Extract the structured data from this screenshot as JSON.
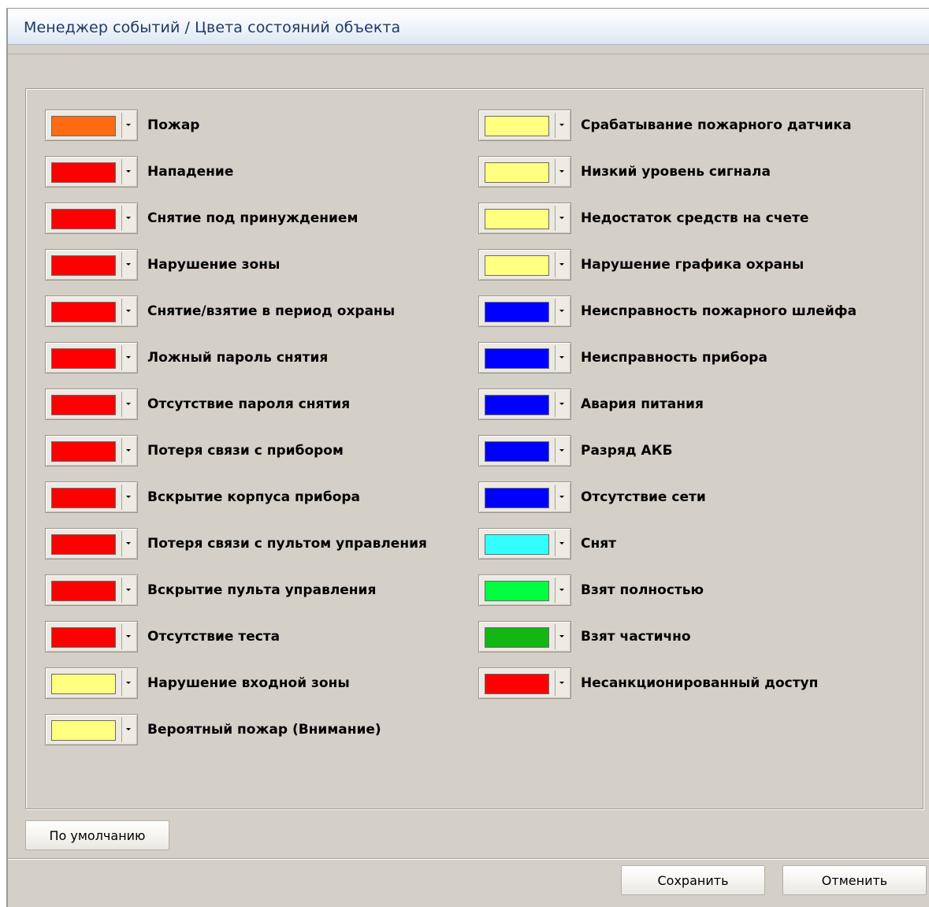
{
  "window": {
    "title": "Менеджер событий / Цвета состояний объекта"
  },
  "left_items": [
    {
      "label": "Пожар",
      "color": "#ff6a13"
    },
    {
      "label": "Нападение",
      "color": "#ff0000"
    },
    {
      "label": "Снятие под принуждением",
      "color": "#ff0000"
    },
    {
      "label": "Нарушение зоны",
      "color": "#ff0000"
    },
    {
      "label": "Снятие/взятие в период охраны",
      "color": "#ff0000"
    },
    {
      "label": "Ложный пароль снятия",
      "color": "#ff0000"
    },
    {
      "label": "Отсутствие пароля снятия",
      "color": "#ff0000"
    },
    {
      "label": "Потеря связи с прибором",
      "color": "#ff0000"
    },
    {
      "label": "Вскрытие корпуса прибора",
      "color": "#ff0000"
    },
    {
      "label": "Потеря связи с пультом управления",
      "color": "#ff0000"
    },
    {
      "label": "Вскрытие пульта управления",
      "color": "#ff0000"
    },
    {
      "label": "Отсутствие теста",
      "color": "#ff0000"
    },
    {
      "label": "Нарушение входной зоны",
      "color": "#ffff80"
    },
    {
      "label": "Вероятный пожар (Внимание)",
      "color": "#ffff80"
    }
  ],
  "right_items": [
    {
      "label": "Срабатывание пожарного датчика",
      "color": "#ffff80"
    },
    {
      "label": "Низкий уровень сигнала",
      "color": "#ffff80"
    },
    {
      "label": "Недостаток средств на счете",
      "color": "#ffff80"
    },
    {
      "label": "Нарушение графика охраны",
      "color": "#ffff80"
    },
    {
      "label": "Неисправность пожарного шлейфа",
      "color": "#0000ff"
    },
    {
      "label": "Неисправность прибора",
      "color": "#0000ff"
    },
    {
      "label": "Авария питания",
      "color": "#0000ff"
    },
    {
      "label": "Разряд АКБ",
      "color": "#0000ff"
    },
    {
      "label": "Отсутствие сети",
      "color": "#0000ff"
    },
    {
      "label": "Снят",
      "color": "#33ffff"
    },
    {
      "label": "Взят полностью",
      "color": "#00ff40"
    },
    {
      "label": "Взят частично",
      "color": "#13b713"
    },
    {
      "label": "Несанкционированный доступ",
      "color": "#ff0000"
    }
  ],
  "buttons": {
    "default": "По умолчанию",
    "save": "Сохранить",
    "cancel": "Отменить"
  }
}
